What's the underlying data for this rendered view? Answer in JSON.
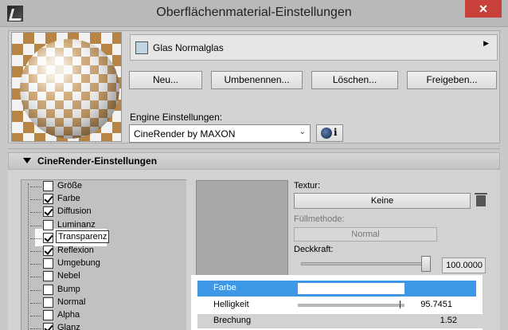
{
  "window": {
    "title": "Oberflächenmaterial-Einstellungen",
    "close_glyph": "✕"
  },
  "material": {
    "name": "Glas Normalglas",
    "swatch_color": "#bfd5e4",
    "expand_glyph": "▶"
  },
  "buttons": {
    "new": "Neu...",
    "rename": "Umbenennen...",
    "delete": "Löschen...",
    "share": "Freigeben..."
  },
  "engine": {
    "label": "Engine Einstellungen:",
    "selected": "CineRender by MAXON",
    "chevron": "⌄",
    "info_glyph": "i"
  },
  "section": {
    "title": "CineRender-Einstellungen"
  },
  "channels": [
    {
      "label": "Größe",
      "checked": false
    },
    {
      "label": "Farbe",
      "checked": true
    },
    {
      "label": "Diffusion",
      "checked": true
    },
    {
      "label": "Luminanz",
      "checked": false
    },
    {
      "label": "Transparenz",
      "checked": true,
      "focused": true
    },
    {
      "label": "Reflexion",
      "checked": true
    },
    {
      "label": "Umgebung",
      "checked": false
    },
    {
      "label": "Nebel",
      "checked": false
    },
    {
      "label": "Bump",
      "checked": false
    },
    {
      "label": "Normal",
      "checked": false
    },
    {
      "label": "Alpha",
      "checked": false
    },
    {
      "label": "Glanz",
      "checked": true
    }
  ],
  "properties": {
    "texture_label": "Textur:",
    "texture_value": "Keine",
    "fill_method_label": "Füllmethode:",
    "fill_method_value": "Normal",
    "opacity_label": "Deckkraft:",
    "opacity_value": "100.0000",
    "opacity_fraction": 1.0
  },
  "popup": {
    "rows": [
      {
        "label": "Farbe",
        "value": "",
        "selected": true
      },
      {
        "label": "Helligkeit",
        "value": "95.7451",
        "level": 0.957
      },
      {
        "label": "Brechung",
        "value": "1.52"
      }
    ],
    "color_value": "#ffffff"
  }
}
